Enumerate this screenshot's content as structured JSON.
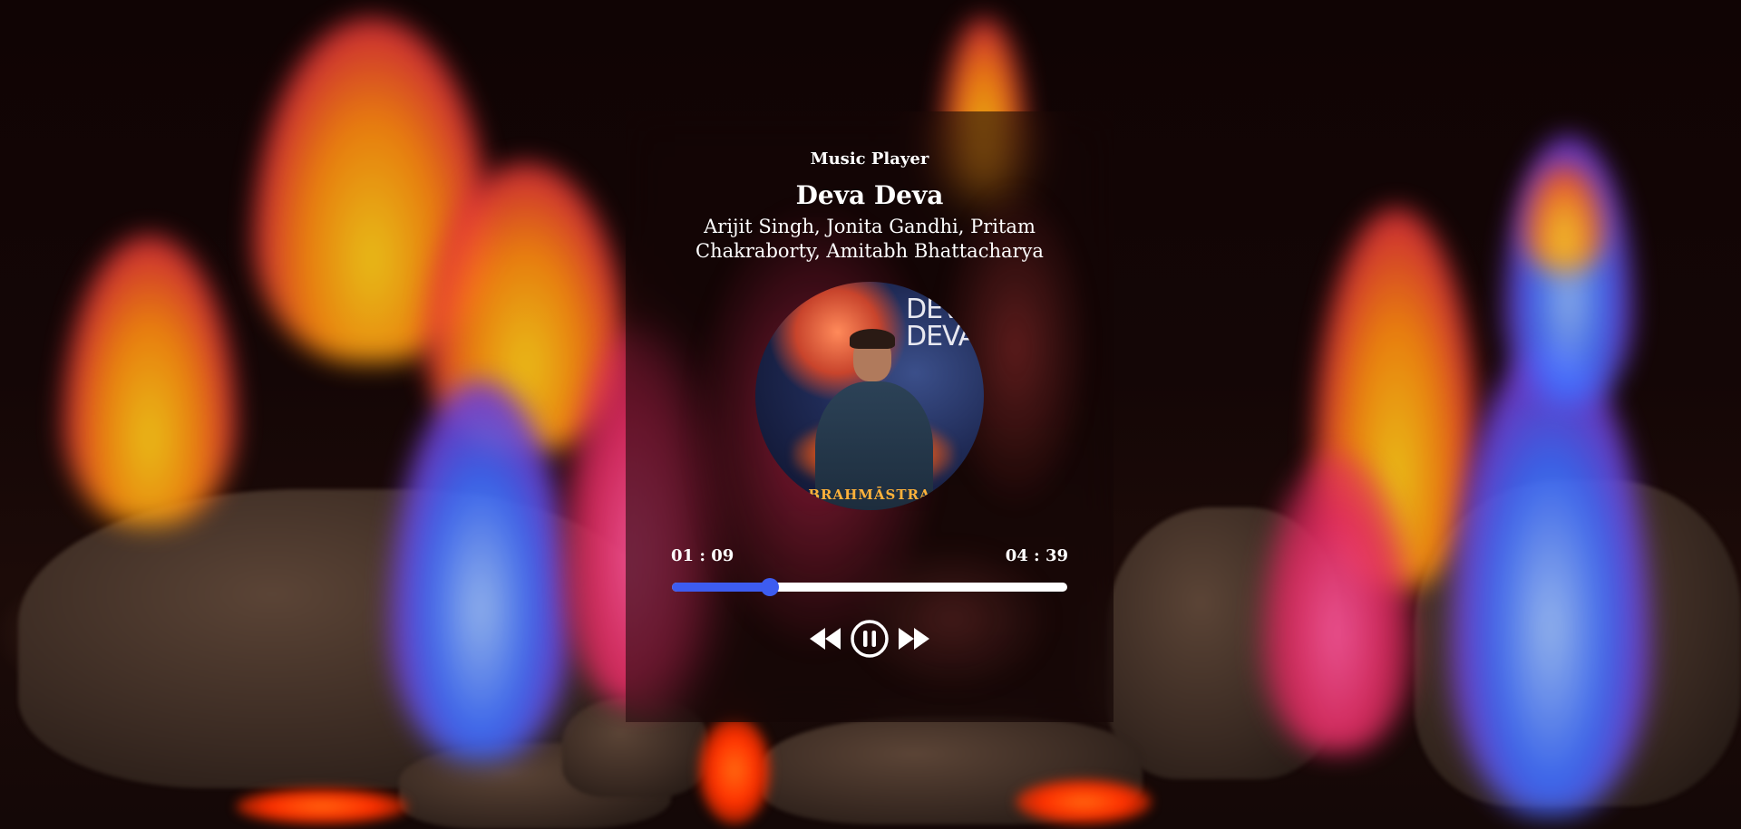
{
  "app": {
    "title": "Music Player"
  },
  "track": {
    "title": "Deva Deva",
    "artists": "Arijit Singh, Jonita Gandhi, Pritam Chakraborty, Amitabh Bhattacharya",
    "cover_text": "DEVA DEVA",
    "cover_brand": "BRAHMĀSTRA"
  },
  "playback": {
    "current_time": "01 : 09",
    "total_time": "04 : 39",
    "progress_fraction": 0.247,
    "state": "playing"
  },
  "controls": {
    "previous_icon": "rewind-icon",
    "play_pause_icon": "pause-circle-icon",
    "next_icon": "fast-forward-icon"
  },
  "colors": {
    "accent": "#3d5cf0",
    "track": "#ffffff",
    "text": "#ffffff"
  }
}
